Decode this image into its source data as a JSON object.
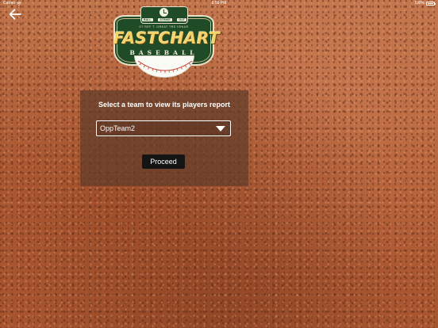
{
  "status_bar": {
    "carrier": "Carrier",
    "time": "6:56 PM",
    "battery": "100%"
  },
  "navigation": {
    "back_icon": "arrow-left-icon"
  },
  "logo": {
    "counts": [
      "BALL",
      "STRIKE",
      "OUT"
    ],
    "small_text": "ST REF  T. GREAT TRE VENUE",
    "title": "FASTCHART",
    "subtitle": "BASEBALL"
  },
  "panel": {
    "title": "Select a team to view its players report",
    "team_select": {
      "selected_value": "OppTeam2",
      "icon": "triangle-down-icon"
    },
    "proceed_label": "Proceed"
  },
  "colors": {
    "dirt": "#b5623a",
    "panel_overlay": "#5f3c2a",
    "logo_green": "#1f4b26",
    "logo_gold": "#f3d36b",
    "button": "#141414"
  }
}
